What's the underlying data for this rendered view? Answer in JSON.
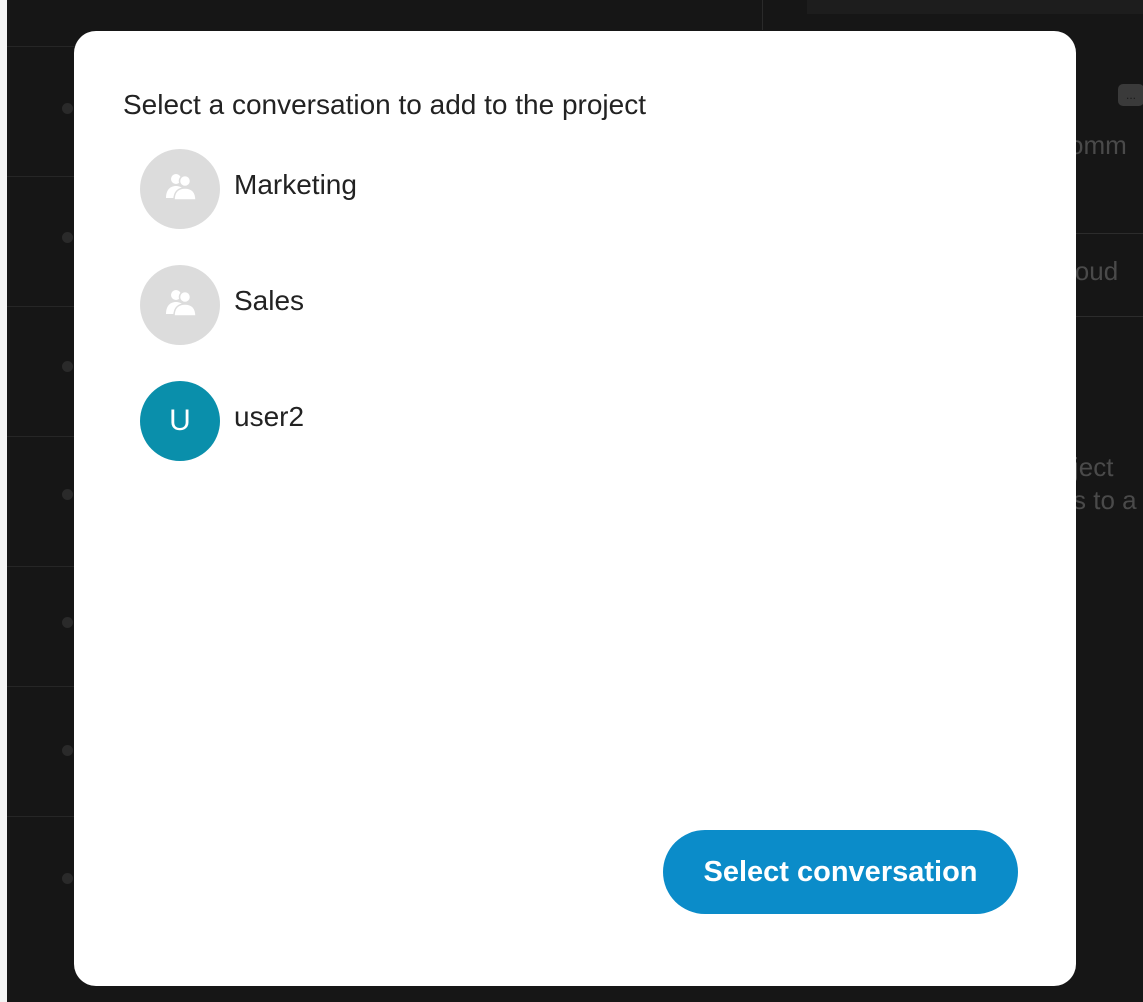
{
  "dialog": {
    "title": "Select a conversation to add to the project",
    "conversations": [
      {
        "name": "Marketing",
        "avatar": "group-icon"
      },
      {
        "name": "Sales",
        "avatar": "group-icon"
      },
      {
        "name": "user2",
        "avatar": "initial",
        "initial": "U"
      }
    ],
    "select_button_label": "Select conversation"
  },
  "background": {
    "fragment_1": "omm",
    "fragment_2": "loud",
    "fragment_3": "ject",
    "fragment_4": "s to a",
    "chip_text": "..."
  },
  "colors": {
    "overlay": "#141414",
    "modal_bg": "#ffffff",
    "accent": "#0b8cc9",
    "user_avatar": "#0a8fab",
    "group_avatar": "#dcdcdc"
  }
}
